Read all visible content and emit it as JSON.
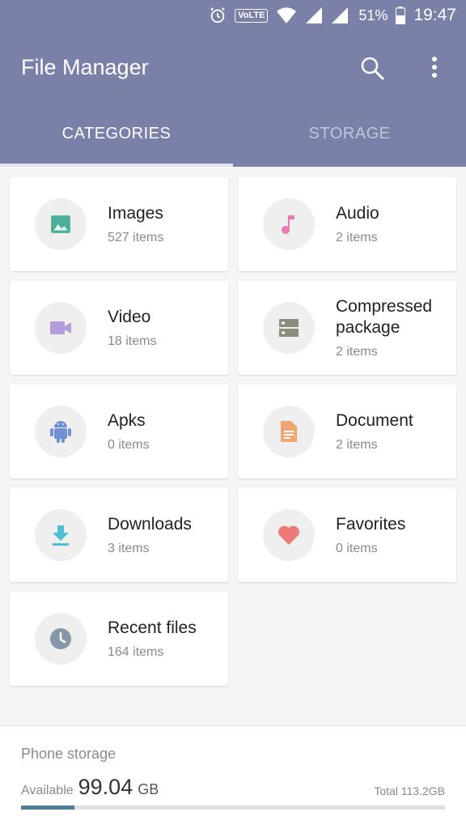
{
  "status_bar": {
    "volte": "VoLTE",
    "battery_pct": "51%",
    "time": "19:47"
  },
  "app_bar": {
    "title": "File Manager"
  },
  "tabs": [
    {
      "label": "CATEGORIES",
      "active": true
    },
    {
      "label": "STORAGE",
      "active": false
    }
  ],
  "categories": [
    {
      "name": "Images",
      "count": "527 items",
      "icon": "image-icon",
      "color": "#4caf9a"
    },
    {
      "name": "Audio",
      "count": "2 items",
      "icon": "music-note-icon",
      "color": "#e77bb8"
    },
    {
      "name": "Video",
      "count": "18 items",
      "icon": "video-camera-icon",
      "color": "#b39ddb"
    },
    {
      "name": "Compressed package",
      "count": "2 items",
      "icon": "archive-icon",
      "color": "#8a8f7d"
    },
    {
      "name": "Apks",
      "count": "0 items",
      "icon": "android-icon",
      "color": "#6f8fd6"
    },
    {
      "name": "Document",
      "count": "2 items",
      "icon": "document-icon",
      "color": "#f0a673"
    },
    {
      "name": "Downloads",
      "count": "3 items",
      "icon": "download-icon",
      "color": "#4dc0d6"
    },
    {
      "name": "Favorites",
      "count": "0 items",
      "icon": "heart-icon",
      "color": "#ec7a78"
    },
    {
      "name": "Recent files",
      "count": "164 items",
      "icon": "clock-icon",
      "color": "#8796a8"
    }
  ],
  "storage": {
    "title": "Phone storage",
    "available_label": "Available",
    "available_value": "99.04",
    "available_unit": "GB",
    "total": "Total 113.2GB",
    "used_fraction": 0.125,
    "bar_color": "#4e7d96"
  }
}
